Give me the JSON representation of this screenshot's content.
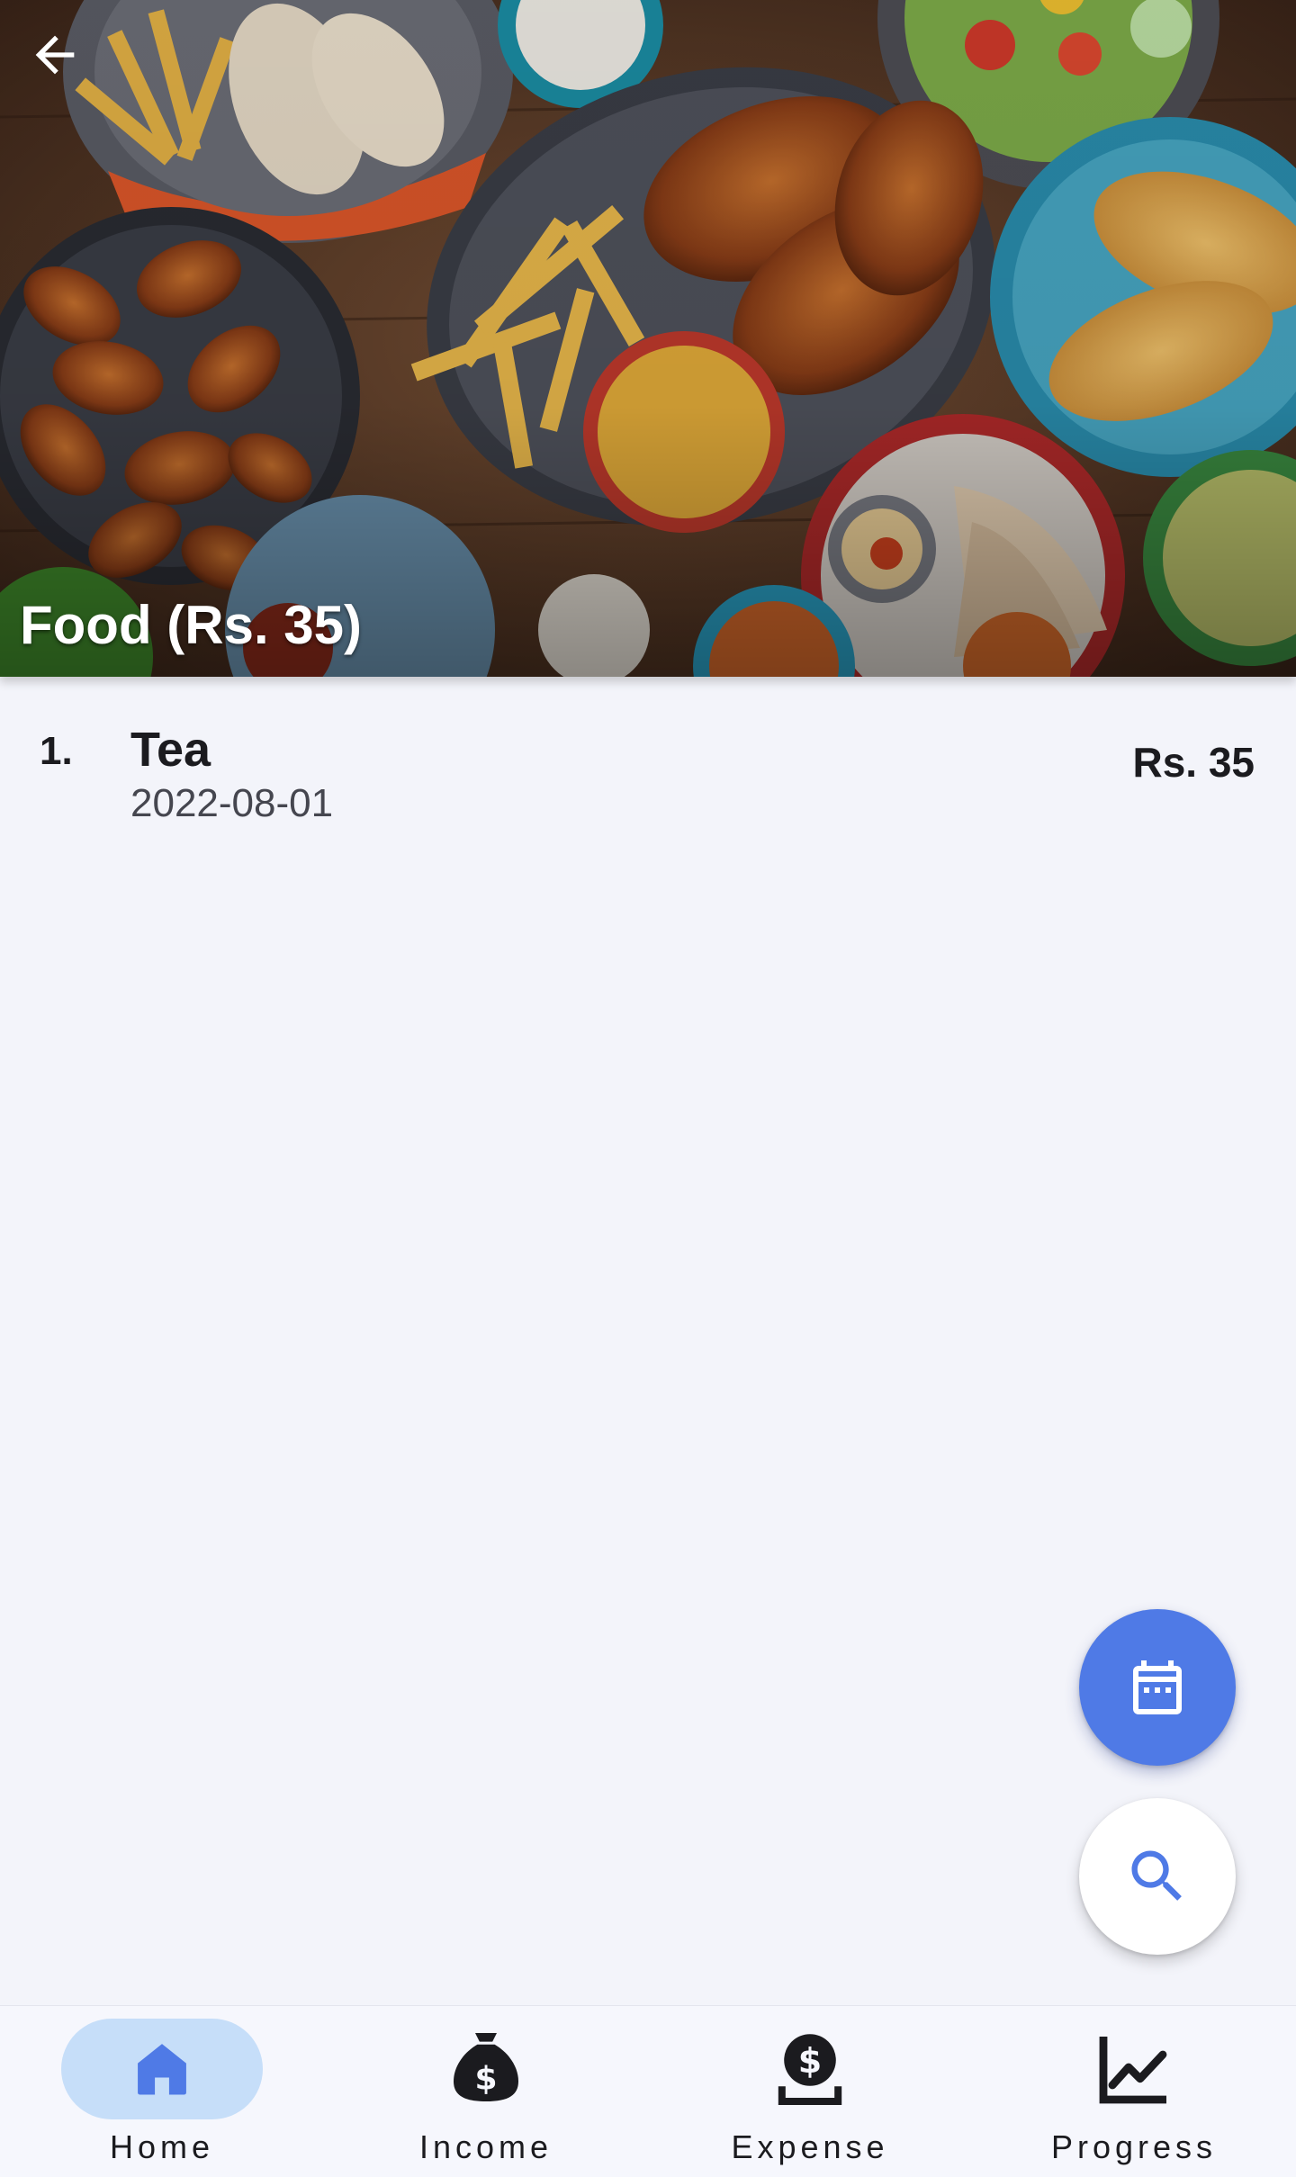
{
  "header": {
    "title": "Food (Rs. 35)",
    "back_icon": "arrow-left-icon"
  },
  "items": [
    {
      "index": "1.",
      "name": "Tea",
      "date": "2022-08-01",
      "amount": "Rs. 35"
    }
  ],
  "fabs": {
    "calendar_icon": "calendar-icon",
    "search_icon": "search-icon"
  },
  "bottom_nav": [
    {
      "label": "Home",
      "icon": "home-icon",
      "active": true
    },
    {
      "label": "Income",
      "icon": "money-bag-icon",
      "active": false
    },
    {
      "label": "Expense",
      "icon": "coin-hand-icon",
      "active": false
    },
    {
      "label": "Progress",
      "icon": "chart-line-icon",
      "active": false
    }
  ],
  "colors": {
    "background": "#f3f4fa",
    "accent": "#4f7ae6",
    "nav_active_pill": "#c6def9"
  }
}
